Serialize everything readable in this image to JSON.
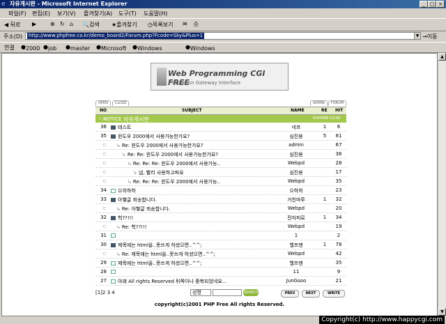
{
  "window": {
    "title": "자유게시판 - Microsoft Internet Explorer"
  },
  "menu": [
    "파일(F)",
    "편집(E)",
    "보기(V)",
    "즐겨찾기(A)",
    "도구(T)",
    "도움말(H)"
  ],
  "toolbar": {
    "back": "뒤로",
    "search": "검색",
    "favorites": "즐겨찾기",
    "history": "목록보기"
  },
  "address": {
    "label": "주소(D)",
    "url": "http://www.phpfree.co.kr/demo_board2/Forum.php?Fcode=Sky&Plus=1",
    "go": "이동"
  },
  "links": {
    "label": "연결",
    "items": [
      "2000",
      "job",
      "master",
      "Microsoft",
      "Windows Update",
      "Windows"
    ]
  },
  "banner": {
    "title": "Web Programming CGI FREE",
    "subtitle": "Common Gateway Interface"
  },
  "tabs": {
    "open": "OPEN",
    "close": "CLOSE",
    "admin": "ADMIN",
    "forum": "FORUM"
  },
  "columns": {
    "no": "NO",
    "subject": "SUBJECT",
    "name": "NAME",
    "re": "RE",
    "hit": "HIT"
  },
  "notice": {
    "label": "NOTICE",
    "board": "자유게시판",
    "site": "PHPFREE.CO.KR"
  },
  "rows": [
    {
      "no": "36",
      "depth": 0,
      "icon": "filled",
      "subject": "테스트",
      "name": "네프",
      "re": "1",
      "hit": "6"
    },
    {
      "no": "35",
      "depth": 0,
      "icon": "filled",
      "subject": "윈도우 2000에서 사용가능한가요?",
      "name": "심진용",
      "re": "5",
      "hit": "81"
    },
    {
      "no": "",
      "depth": 1,
      "icon": "reply",
      "subject": "Re: 윈도우 2000에서 사용가능한가요?",
      "name": "admin",
      "re": "",
      "hit": "67"
    },
    {
      "no": "",
      "depth": 2,
      "icon": "reply",
      "subject": "Re: Re: 윈도우 2000에서 사용가능한가요?",
      "name": "심진용",
      "re": "",
      "hit": "36"
    },
    {
      "no": "",
      "depth": 3,
      "icon": "reply",
      "subject": "Re: Re: Re: 윈도우 2000에서 사용가능..",
      "name": "Webpd",
      "re": "",
      "hit": "28"
    },
    {
      "no": "",
      "depth": 4,
      "icon": "reply",
      "subject": "냅, 빨리 사용하고파요",
      "name": "심진용",
      "re": "",
      "hit": "17"
    },
    {
      "no": "",
      "depth": 3,
      "icon": "reply",
      "subject": "Re: Re: Re: 윈도우 2000에서 사용가능..",
      "name": "Webpd",
      "re": "",
      "hit": "35"
    },
    {
      "no": "34",
      "depth": 0,
      "icon": "empty",
      "subject": "으히하하",
      "name": "으하하",
      "re": "",
      "hit": "23"
    },
    {
      "no": "33",
      "depth": 0,
      "icon": "filled",
      "subject": "아햏글 죄송합니다.",
      "name": "거친마루",
      "re": "1",
      "hit": "32"
    },
    {
      "no": "",
      "depth": 1,
      "icon": "reply",
      "subject": "Re: 아햏글 죄송합니다.",
      "name": "Webpd",
      "re": "",
      "hit": "20"
    },
    {
      "no": "32",
      "depth": 0,
      "icon": "filled",
      "subject": "헉??!!!",
      "name": "전자피로",
      "re": "1",
      "hit": "34"
    },
    {
      "no": "",
      "depth": 1,
      "icon": "reply",
      "subject": "Re: 헉??!!!",
      "name": "Webpd",
      "re": "",
      "hit": "19"
    },
    {
      "no": "31",
      "depth": 0,
      "icon": "empty",
      "subject": "",
      "name": "1",
      "re": "",
      "hit": "2"
    },
    {
      "no": "30",
      "depth": 0,
      "icon": "filled",
      "subject": "제목에는 html을..못쓰게 하셨으면..^^;",
      "name": "헬프맨",
      "re": "1",
      "hit": "78"
    },
    {
      "no": "",
      "depth": 1,
      "icon": "reply",
      "subject": "Re: 제목에는 html을..못쓰게 하셨으면..^^;",
      "name": "Webpd",
      "re": "",
      "hit": "42"
    },
    {
      "no": "29",
      "depth": 0,
      "icon": "empty",
      "subject": "제목에는 html을..못쓰게 하셨으면..^^;",
      "name": "헬프맨",
      "re": "",
      "hit": "35"
    },
    {
      "no": "28",
      "depth": 0,
      "icon": "empty",
      "subject": "",
      "name": "11",
      "re": "",
      "hit": "9"
    },
    {
      "no": "27",
      "depth": 0,
      "icon": "empty",
      "subject": "아래 All rights Reserved 뒤쪽이나 중복되었네요...",
      "name": "JunGsoo",
      "re": "",
      "hit": "21"
    }
  ],
  "pager": "[1]2 3 4",
  "search": {
    "select": "성명",
    "button": "SEARCH"
  },
  "nav": {
    "prev": "PREV",
    "next": "NEXT",
    "write": "WRITE"
  },
  "copyright": "copyright(c)2001 PHP Free All rights Reserved.",
  "watermark": "Copyright(c) http://www.happycgi.com"
}
